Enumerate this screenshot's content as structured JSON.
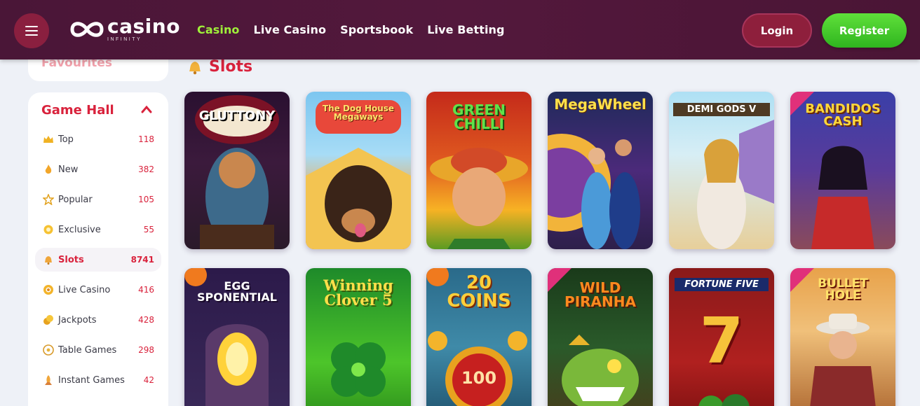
{
  "header": {
    "logo_main": "casino",
    "logo_sub": "INFINITY",
    "nav": [
      "Casino",
      "Live Casino",
      "Sportsbook",
      "Live Betting"
    ],
    "login_label": "Login",
    "register_label": "Register"
  },
  "colors": {
    "header_bg": "#4f1739",
    "accent_red": "#d9223c",
    "nav_active": "#9ff03a",
    "register_green": "#3cc52a",
    "login_bg": "#8e1f3c"
  },
  "sidebar": {
    "favourites_label": "Favourites",
    "title": "Game Hall",
    "items": [
      {
        "label": "Top",
        "count": "118",
        "icon": "crown-icon"
      },
      {
        "label": "New",
        "count": "382",
        "icon": "flame-icon"
      },
      {
        "label": "Popular",
        "count": "105",
        "icon": "star-icon"
      },
      {
        "label": "Exclusive",
        "count": "55",
        "icon": "gem-icon"
      },
      {
        "label": "Slots",
        "count": "8741",
        "icon": "bell-icon"
      },
      {
        "label": "Live Casino",
        "count": "416",
        "icon": "chip-icon"
      },
      {
        "label": "Jackpots",
        "count": "428",
        "icon": "coins-icon"
      },
      {
        "label": "Table Games",
        "count": "298",
        "icon": "dice-icon"
      },
      {
        "label": "Instant Games",
        "count": "42",
        "icon": "rocket-icon"
      }
    ]
  },
  "section": {
    "title": "Slots",
    "icon": "bell-icon"
  },
  "games": [
    {
      "title": "GLUTTONY"
    },
    {
      "title": "The Dog House Megaways"
    },
    {
      "title": "GREEN CHILLI"
    },
    {
      "title": "MegaWheel"
    },
    {
      "title": "DEMI GODS V"
    },
    {
      "title": "BANDIDOS CASH"
    },
    {
      "title": "EGG SPONENTIAL"
    },
    {
      "title": "Winning Clover 5"
    },
    {
      "title": "20 COINS"
    },
    {
      "title": "WILD PIRANHA"
    },
    {
      "title": "FORTUNE FIVE"
    },
    {
      "title": "BULLET HOLE"
    }
  ],
  "tile_badges": {
    "coin": "100",
    "seven": "7"
  }
}
